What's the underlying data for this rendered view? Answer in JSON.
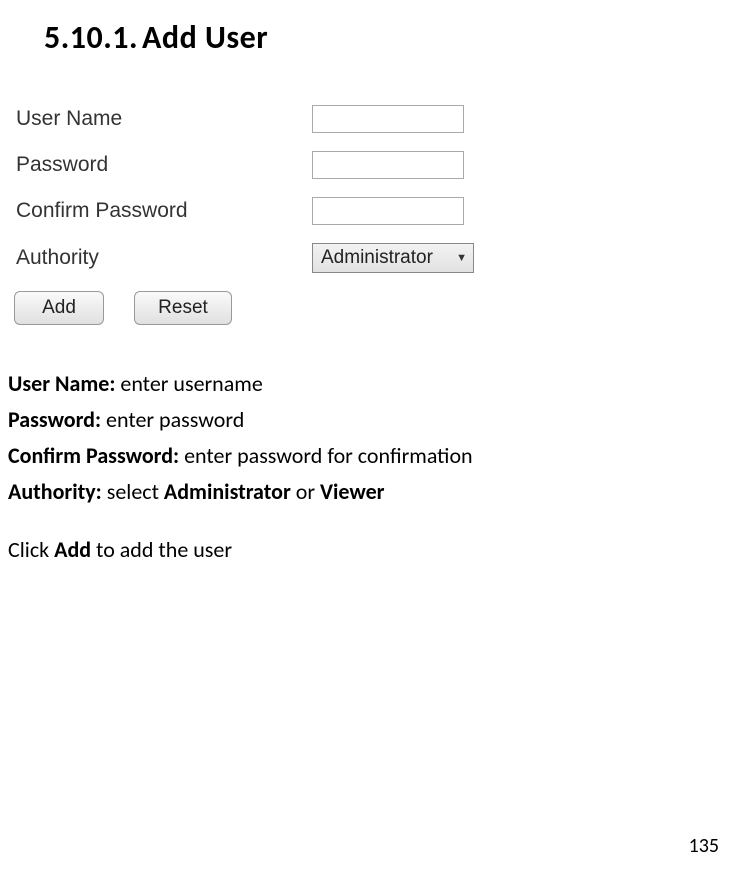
{
  "heading": {
    "number": "5.10.1.",
    "title": "Add User"
  },
  "form": {
    "username_label": "User Name",
    "username_value": "",
    "password_label": "Password",
    "password_value": "",
    "confirm_label": "Confirm Password",
    "confirm_value": "",
    "authority_label": "Authority",
    "authority_selected": "Administrator"
  },
  "buttons": {
    "add": "Add",
    "reset": "Reset"
  },
  "descriptions": {
    "username_bold": "User Name:",
    "username_text": " enter username",
    "password_bold": "Password:",
    "password_text": " enter password",
    "confirm_bold": "Confirm Password:",
    "confirm_text": " enter password for confirmation",
    "authority_bold": "Authority:",
    "authority_text_pre": " select ",
    "authority_opt1": "Administrator",
    "authority_text_mid": " or ",
    "authority_opt2": "Viewer",
    "click_pre": "Click ",
    "click_bold": "Add",
    "click_post": " to add the user"
  },
  "page_number": "135"
}
